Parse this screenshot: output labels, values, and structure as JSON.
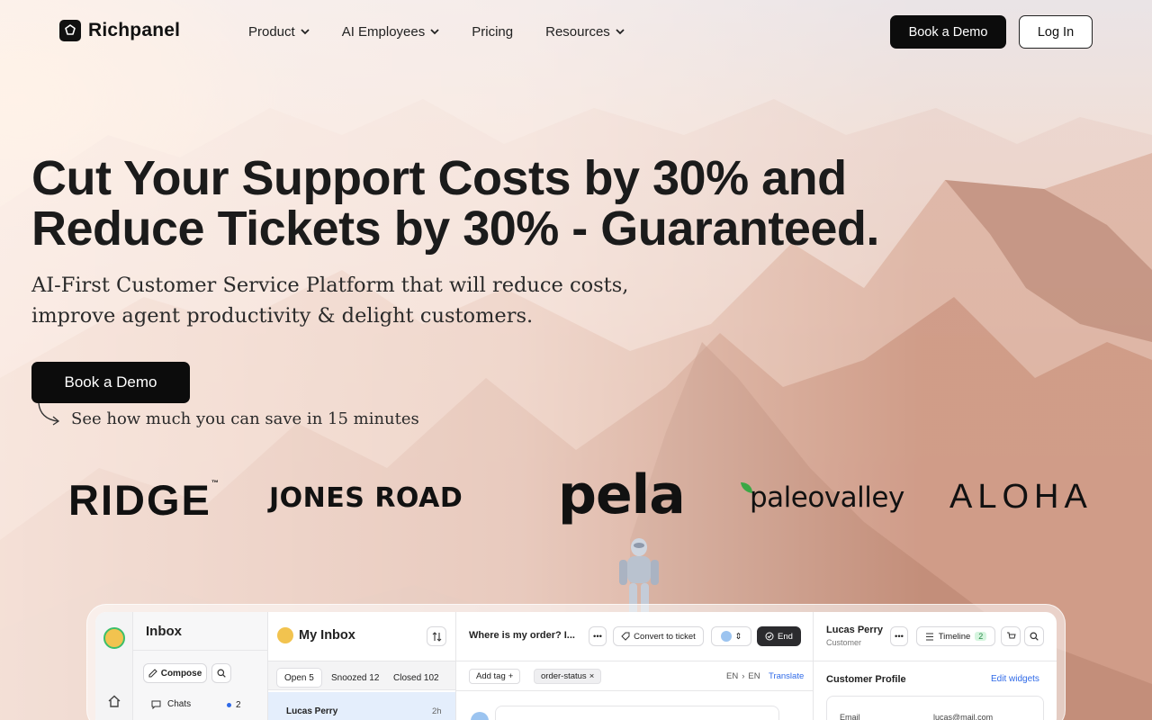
{
  "nav": {
    "brand": "Richpanel",
    "menu": [
      {
        "label": "Product",
        "has_dropdown": true
      },
      {
        "label": "AI Employees",
        "has_dropdown": true
      },
      {
        "label": "Pricing",
        "has_dropdown": false
      },
      {
        "label": "Resources",
        "has_dropdown": true
      }
    ],
    "book_demo": "Book a Demo",
    "login": "Log In"
  },
  "hero": {
    "headline_line1": "Cut Your Support Costs by 30% and",
    "headline_line2": "Reduce Tickets by 30% - Guaranteed.",
    "subtitle_line1": "AI-First Customer Service Platform that will reduce costs,",
    "subtitle_line2": "improve agent productivity & delight customers.",
    "cta": "Book a Demo",
    "cta_note": "See how much you can save in 15 minutes"
  },
  "customer_logos": [
    "RIDGE",
    "JONES ROAD",
    "pela",
    "paleovalley",
    "ALOHA"
  ],
  "ridge_tm": "™",
  "app": {
    "rail": {
      "icons": [
        "avatar",
        "home-icon"
      ]
    },
    "inbox": {
      "title": "Inbox",
      "compose": "Compose",
      "chats_label": "Chats",
      "chats_count": "2"
    },
    "my_inbox": {
      "title": "My Inbox",
      "tabs": [
        {
          "label": "Open 5",
          "active": true
        },
        {
          "label": "Snoozed 12",
          "active": false
        },
        {
          "label": "Closed 102",
          "active": false
        }
      ],
      "rows": [
        {
          "name": "Lucas Perry",
          "time": "2h",
          "selected": true
        }
      ]
    },
    "conversation": {
      "title": "Where is my order? I...",
      "convert": "Convert to ticket",
      "end": "End",
      "add_tag": "Add tag",
      "tag": "order-status",
      "lang_from": "EN",
      "lang_to": "EN",
      "translate": "Translate"
    },
    "profile": {
      "name": "Lucas Perry",
      "role": "Customer",
      "timeline": "Timeline",
      "timeline_count": "2",
      "section": "Customer Profile",
      "edit": "Edit widgets",
      "email_label": "Email",
      "email_value": "lucas@mail.com"
    }
  },
  "colors": {
    "primary": "#0c0c0c",
    "link": "#2f6ae8",
    "selected_row": "#e4eefc",
    "badge_bg": "#d6f5df"
  }
}
